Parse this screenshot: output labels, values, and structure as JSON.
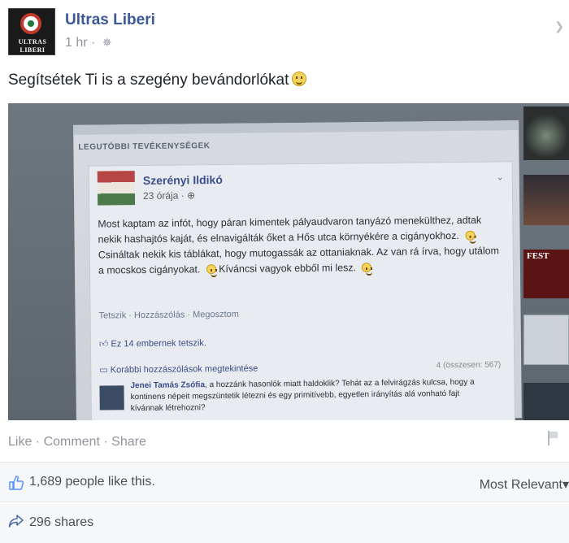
{
  "post": {
    "page_name": "Ultras Liberi",
    "avatar_line1": "ULTRAS",
    "avatar_line2": "LIBERI",
    "time": "1 hr",
    "separator": " · ",
    "text": "Segítsétek Ti is a szegény bevándorlókat"
  },
  "photo": {
    "section_title": "LEGUTÓBBI TEVÉKENYSÉGEK",
    "inner_name": "Szerényi Ildikó",
    "inner_time": "23 órája",
    "inner_body_1": "Most kaptam az infót, hogy páran kimentek pályaudvaron tanyázó menekülthez, adtak nekik hashajtós kaját, és elnavigálták őket a Hős utca környékére a cigányokhoz.",
    "inner_body_2": "Csináltak nekik kis táblákat, hogy mutogassák az ottaniaknak. Az van rá írva, hogy utálom a mocskos cigányokat.",
    "inner_body_3": "Kíváncsi vagyok ebből mi lesz.",
    "inner_links": "Tetszik · Hozzászólás · Megosztom",
    "inner_likes": "Ez 14 embernek tetszik.",
    "inner_more": "Korábbi hozzászólások megtekintése",
    "inner_count": "4 (összesen: 567)",
    "inner_comment_name": "Jenei Tamás Zsófia",
    "inner_comment_text": ", a hozzánk hasonlók miatt haldoklik? Tehát az a felvirágzás kulcsa, hogy a kontinens népeit megszüntetik létezni és egy primitívebb, egyetlen irányítás alá vonható fajt kívánnak létrehozni?",
    "side_fest": "FEST"
  },
  "actions": {
    "like": "Like",
    "comment": "Comment",
    "share": "Share",
    "sep": " · "
  },
  "stats": {
    "likes": "1,689 people like this.",
    "relevance": "Most Relevant",
    "shares": "296 shares"
  },
  "icons": {
    "globe": "globe-icon",
    "caret": "chevron-down-icon",
    "flag": "flag-icon",
    "thumbs_up": "thumbs-up-icon",
    "share": "share-arrow-icon"
  },
  "colors": {
    "link": "#3b5998",
    "meta": "#90949c",
    "bar_bg": "#f6f7f9"
  }
}
